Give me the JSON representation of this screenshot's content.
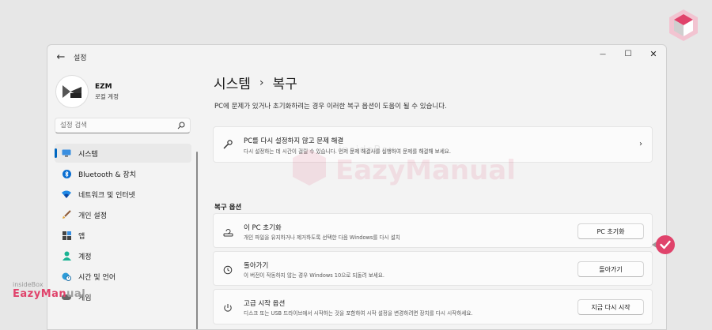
{
  "window": {
    "back_glyph": "←",
    "app_title": "설정",
    "controls": {
      "minimize": "—",
      "maximize": "☐",
      "close": "✕"
    }
  },
  "profile": {
    "name": "EZM",
    "account_type": "로컬 계정"
  },
  "search": {
    "placeholder": "설정 검색"
  },
  "nav": [
    {
      "label": "시스템",
      "icon": "display-icon",
      "active": true
    },
    {
      "label": "Bluetooth & 장치",
      "icon": "bluetooth-icon",
      "active": false
    },
    {
      "label": "네트워크 및 인터넷",
      "icon": "wifi-icon",
      "active": false
    },
    {
      "label": "개인 설정",
      "icon": "brush-icon",
      "active": false
    },
    {
      "label": "앱",
      "icon": "apps-icon",
      "active": false
    },
    {
      "label": "계정",
      "icon": "person-icon",
      "active": false
    },
    {
      "label": "시간 및 언어",
      "icon": "globe-clock-icon",
      "active": false
    },
    {
      "label": "게임",
      "icon": "gamepad-icon",
      "active": false
    }
  ],
  "breadcrumb": {
    "parent": "시스템",
    "separator": "›",
    "current": "복구"
  },
  "page": {
    "description": "PC에 문제가 있거나 초기화하려는 경우 이러한 복구 옵션이 도움이 될 수 있습니다."
  },
  "troubleshoot": {
    "title": "PC를 다시 설정하지 않고 문제 해결",
    "desc": "다시 설정하는 데 시간이 걸릴 수 있습니다. 먼저 문제 해결사를 실행하여 문제를 해결해 보세요.",
    "chevron": "›"
  },
  "recovery_section": {
    "heading": "복구 옵션"
  },
  "options": [
    {
      "title": "이 PC 초기화",
      "desc": "개인 파일을 유지하거나 제거하도록 선택한 다음 Windows를 다시 설치",
      "button": "PC 초기화"
    },
    {
      "title": "돌아가기",
      "desc": "이 버전이 작동하지 않는 경우 Windows 10으로 되돌려 보세요.",
      "button": "돌아가기"
    },
    {
      "title": "고급 시작 옵션",
      "desc": "디스크 또는 USB 드라이브에서 시작하는 것을 포함하여 시작 설정을 변경하려면 장치를 다시 시작하세요.",
      "button": "지금 다시 시작"
    }
  ],
  "watermark": {
    "line1": "insideBox",
    "line2": "EazyManual"
  },
  "bottom_logo": {
    "line1": "insideBox",
    "line2a": "EazyMan",
    "line2b": "ual"
  },
  "colors": {
    "accent": "#0067c0",
    "brand_pink": "#e0436b",
    "background": "#f3f3f3"
  }
}
